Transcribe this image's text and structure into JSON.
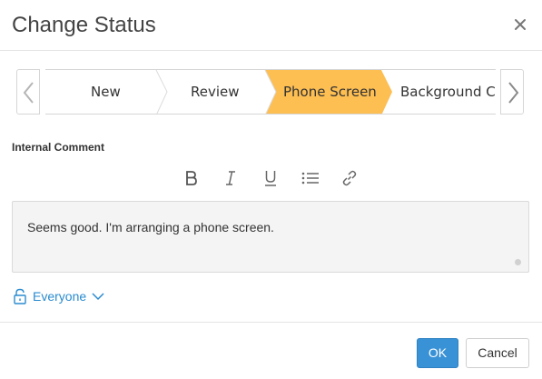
{
  "dialog": {
    "title": "Change Status",
    "close_icon": "close-icon"
  },
  "stepper": {
    "prev_icon": "chevron-left-icon",
    "next_icon": "chevron-right-icon",
    "steps": [
      {
        "label": "New",
        "active": false
      },
      {
        "label": "Review",
        "active": false
      },
      {
        "label": "Phone Screen",
        "active": true
      },
      {
        "label": "Background Ch",
        "active": false
      }
    ],
    "active_color": "#FDBE52"
  },
  "comment": {
    "label": "Internal Comment",
    "toolbar": [
      "bold-icon",
      "italic-icon",
      "underline-icon",
      "bulleted-list-icon",
      "link-icon"
    ],
    "text": "Seems good. I'm arranging a phone screen."
  },
  "visibility": {
    "label": "Everyone",
    "icon": "unlock-icon"
  },
  "footer": {
    "ok_label": "OK",
    "cancel_label": "Cancel",
    "ok_color": "#3A92D6"
  }
}
